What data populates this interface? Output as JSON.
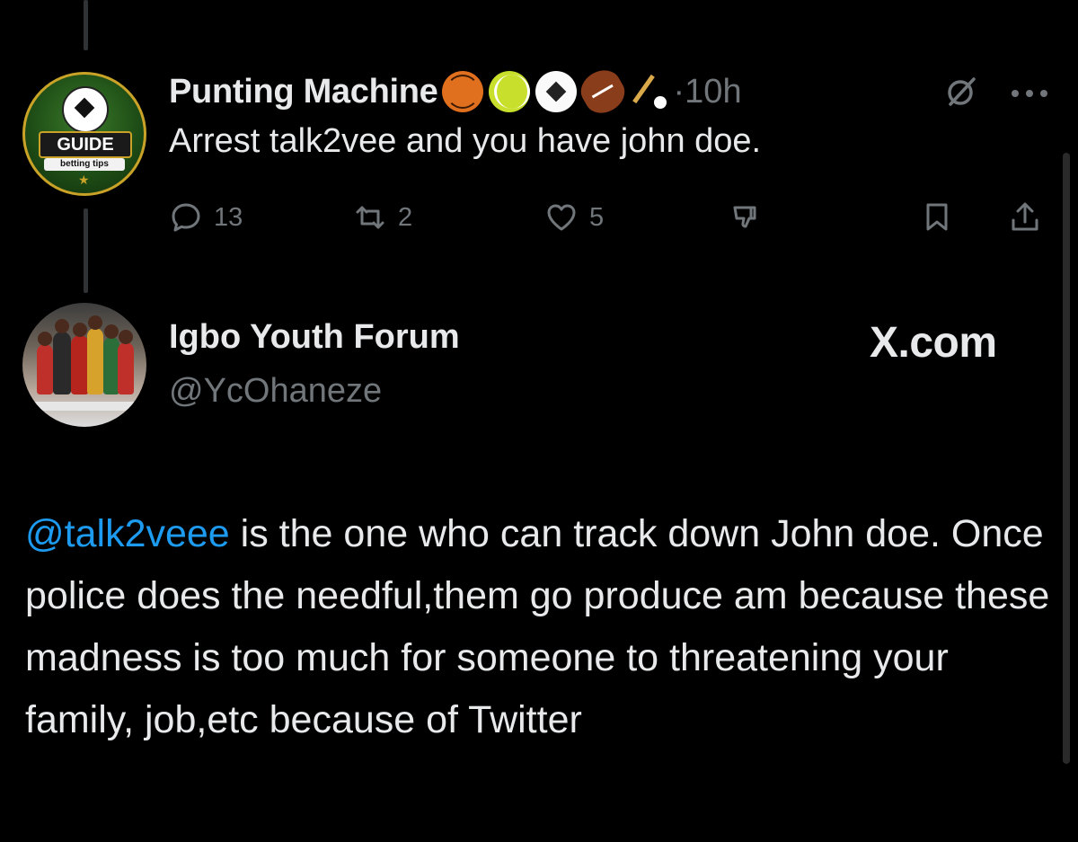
{
  "tweet": {
    "display_name": "Punting Machine",
    "badges": [
      "basketball-icon",
      "tennis-ball-icon",
      "soccer-ball-icon",
      "american-football-icon",
      "hockey-stick-icon"
    ],
    "timestamp": "·10h",
    "avatar_text": {
      "banner": "GUIDE",
      "sub": "betting tips"
    },
    "text": "Arrest talk2vee and you have john doe.",
    "actions": {
      "replies": "13",
      "reposts": "2",
      "likes": "5"
    }
  },
  "quoted": {
    "display_name": "Igbo Youth Forum",
    "handle": "@YcOhaneze",
    "source": "X.com",
    "mention": "@talk2veee",
    "body": " is the one who can track down John doe. Once police does the needful,them go produce am because these madness is too much for someone to threatening your family, job,etc because of Twitter"
  },
  "colors": {
    "background": "#000000",
    "text": "#e7e9ea",
    "muted": "#71767b",
    "link": "#1d9bf0"
  }
}
